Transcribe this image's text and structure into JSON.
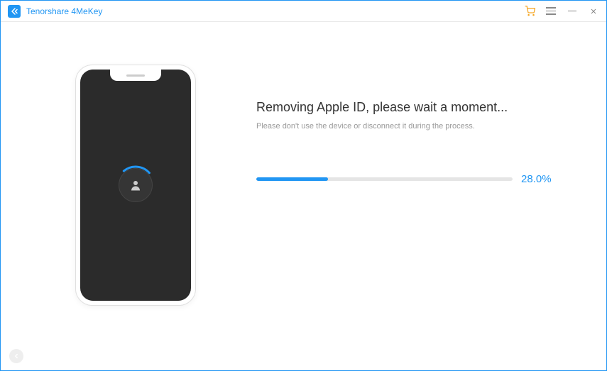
{
  "app": {
    "title": "Tenorshare 4MeKey"
  },
  "main": {
    "heading": "Removing Apple ID, please wait a moment...",
    "subtext": "Please don't use the device or disconnect it during the process."
  },
  "progress": {
    "percent": 28.0,
    "label": "28.0%"
  },
  "colors": {
    "accent": "#2196f3"
  }
}
